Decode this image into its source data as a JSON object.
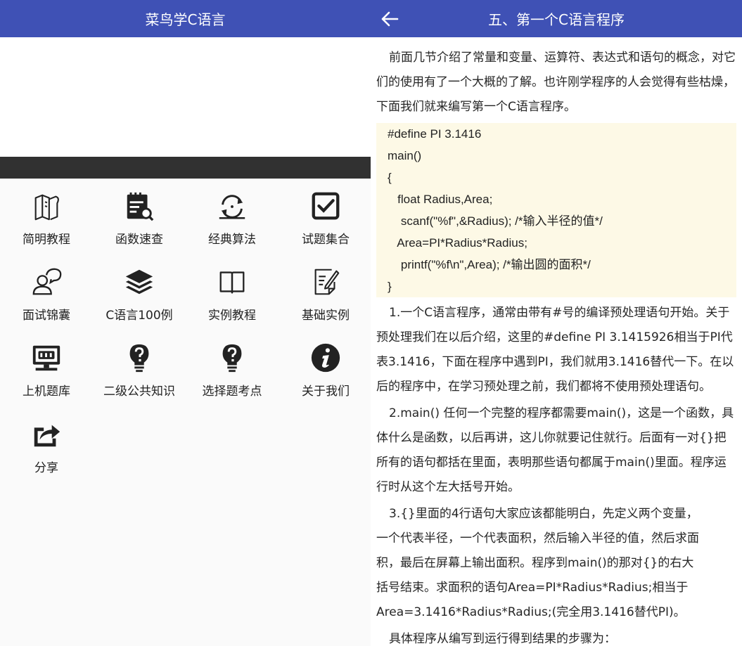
{
  "left": {
    "title": "菜鸟学C语言",
    "menu": [
      {
        "label": "简明教程",
        "icon": "books-icon"
      },
      {
        "label": "函数速查",
        "icon": "calendar-search-icon"
      },
      {
        "label": "经典算法",
        "icon": "refresh-cycle-icon"
      },
      {
        "label": "试题集合",
        "icon": "checkbox-icon"
      },
      {
        "label": "面试锦囊",
        "icon": "user-chat-icon"
      },
      {
        "label": "C语言100例",
        "icon": "layers-icon"
      },
      {
        "label": "实例教程",
        "icon": "open-book-icon"
      },
      {
        "label": "基础实例",
        "icon": "edit-document-icon"
      },
      {
        "label": "上机题库",
        "icon": "monitor-icon"
      },
      {
        "label": "二级公共知识",
        "icon": "lightbulb-question-icon"
      },
      {
        "label": "选择题考点",
        "icon": "lightbulb-question-icon"
      },
      {
        "label": "关于我们",
        "icon": "info-icon"
      },
      {
        "label": "分享",
        "icon": "share-icon"
      }
    ]
  },
  "right": {
    "title": "五、第一个C语言程序",
    "intro": "前面几节介绍了常量和变量、运算符、表达式和语句的概念，对它们的使用有了一个大概的了解。也许刚学程序的人会觉得有些枯燥，下面我们就来编写第一个C语言程序。",
    "code": [
      "#define PI 3.1416",
      "main()",
      "{",
      "   float Radius,Area;",
      "    scanf(\"%f\",&Radius); /*输入半径的值*/",
      "   Area=PI*Radius*Radius;",
      "    printf(\"%f\\n\",Area); /*输出圆的面积*/",
      "}"
    ],
    "p1": "1.一个C语言程序，通常由带有#号的编译预处理语句开始。关于预处理我们在以后介绍，这里的#define PI 3.1415926相当于PI代表3.1416，下面在程序中遇到PI，我们就用3.1416替代一下。在以后的程序中，在学习预处理之前，我们都将不使用预处理语句。",
    "p2": "2.main() 任何一个完整的程序都需要main()，这是一个函数，具体什么是函数，以后再讲，这儿你就要记住就行。后面有一对{}把所有的语句都括在里面，表明那些语句都属于main()里面。程序运行时从这个左大括号开始。",
    "p3": "3.{}里面的4行语句大家应该都能明白，先定义两个变量，一个代表半径，一个代表面积，然后输入半径的值，然后求面积，最后在屏幕上输出面积。程序到main()的那对{}的右大括号结束。求面积的语句Area=PI*Radius*Radius;相当于Area=3.1416*Radius*Radius;(完全用3.1416替代PI)。",
    "p4": "具体程序从编写到运行得到结果的步骤为："
  }
}
